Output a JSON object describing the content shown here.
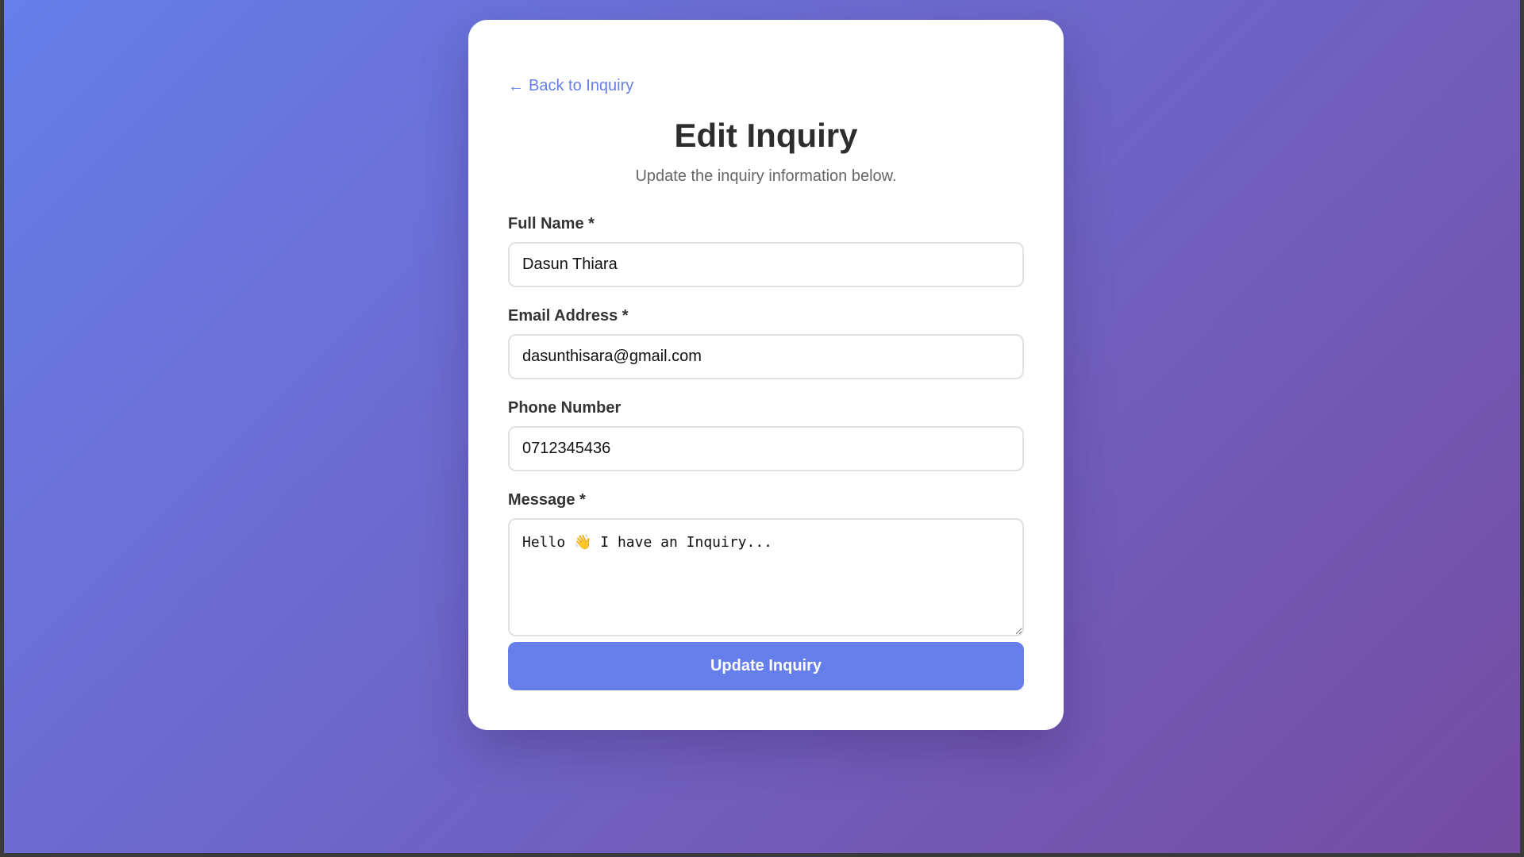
{
  "back_link": {
    "icon": "arrow-left-icon",
    "label": "Back to Inquiry"
  },
  "header": {
    "title": "Edit Inquiry",
    "subtitle": "Update the inquiry information below."
  },
  "form": {
    "full_name": {
      "label": "Full Name *",
      "value": "Dasun Thiara"
    },
    "email": {
      "label": "Email Address *",
      "value": "dasunthisara@gmail.com"
    },
    "phone": {
      "label": "Phone Number",
      "value": "0712345436"
    },
    "message": {
      "label": "Message *",
      "value": "Hello 👋 I have an Inquiry..."
    },
    "submit_label": "Update Inquiry"
  },
  "colors": {
    "accent": "#667eea",
    "background_start": "#667eea",
    "background_end": "#764ba2"
  }
}
